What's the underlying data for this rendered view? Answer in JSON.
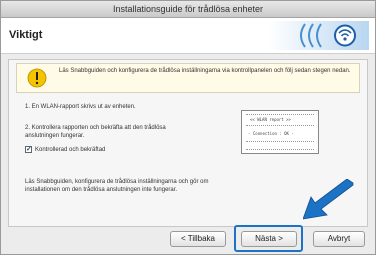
{
  "window": {
    "title": "Installationsguide för trådlösa enheter"
  },
  "header": {
    "title": "Viktigt"
  },
  "notice": {
    "text": "Läs Snabbguiden och konfigurera de trådlösa inställningarna via kontrollpanelen och följ sedan stegen nedan."
  },
  "steps": {
    "step1": "1. En WLAN-rapport skrivs ut av enheten.",
    "step2": "2. Kontrollera rapporten och bekräfta att den trådlösa anslutningen fungerar.",
    "checkbox_label": "Kontrollerad och bekräftad",
    "checkbox_checked": true,
    "footer_text": "Läs Snabbguiden, konfigurera de trådlösa inställningarna och gör om installationen om den trådlösa anslutningen inte fungerar."
  },
  "report": {
    "line1": "<< WLAN report >>",
    "line2": "- Connection : OK -"
  },
  "buttons": {
    "back": "< Tillbaka",
    "next": "Nästa >",
    "cancel": "Avbryt"
  },
  "colors": {
    "accent": "#1c73c6",
    "notice_bg": "#fffbe6"
  }
}
